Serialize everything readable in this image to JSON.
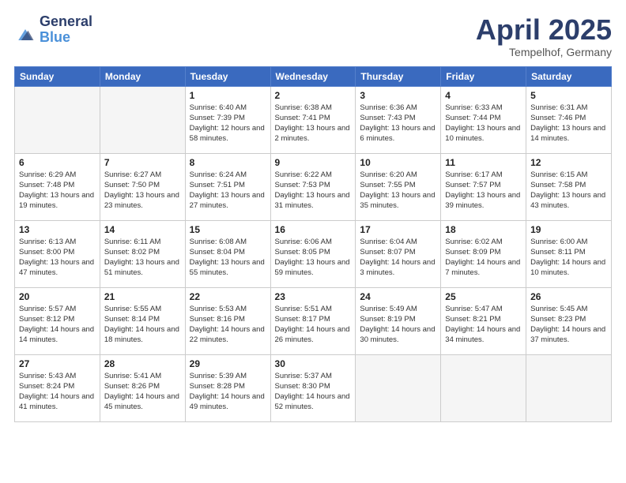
{
  "header": {
    "logo_general": "General",
    "logo_blue": "Blue",
    "month": "April 2025",
    "location": "Tempelhof, Germany"
  },
  "weekdays": [
    "Sunday",
    "Monday",
    "Tuesday",
    "Wednesday",
    "Thursday",
    "Friday",
    "Saturday"
  ],
  "weeks": [
    [
      {
        "day": "",
        "sunrise": "",
        "sunset": "",
        "daylight": ""
      },
      {
        "day": "",
        "sunrise": "",
        "sunset": "",
        "daylight": ""
      },
      {
        "day": "1",
        "sunrise": "Sunrise: 6:40 AM",
        "sunset": "Sunset: 7:39 PM",
        "daylight": "Daylight: 12 hours and 58 minutes."
      },
      {
        "day": "2",
        "sunrise": "Sunrise: 6:38 AM",
        "sunset": "Sunset: 7:41 PM",
        "daylight": "Daylight: 13 hours and 2 minutes."
      },
      {
        "day": "3",
        "sunrise": "Sunrise: 6:36 AM",
        "sunset": "Sunset: 7:43 PM",
        "daylight": "Daylight: 13 hours and 6 minutes."
      },
      {
        "day": "4",
        "sunrise": "Sunrise: 6:33 AM",
        "sunset": "Sunset: 7:44 PM",
        "daylight": "Daylight: 13 hours and 10 minutes."
      },
      {
        "day": "5",
        "sunrise": "Sunrise: 6:31 AM",
        "sunset": "Sunset: 7:46 PM",
        "daylight": "Daylight: 13 hours and 14 minutes."
      }
    ],
    [
      {
        "day": "6",
        "sunrise": "Sunrise: 6:29 AM",
        "sunset": "Sunset: 7:48 PM",
        "daylight": "Daylight: 13 hours and 19 minutes."
      },
      {
        "day": "7",
        "sunrise": "Sunrise: 6:27 AM",
        "sunset": "Sunset: 7:50 PM",
        "daylight": "Daylight: 13 hours and 23 minutes."
      },
      {
        "day": "8",
        "sunrise": "Sunrise: 6:24 AM",
        "sunset": "Sunset: 7:51 PM",
        "daylight": "Daylight: 13 hours and 27 minutes."
      },
      {
        "day": "9",
        "sunrise": "Sunrise: 6:22 AM",
        "sunset": "Sunset: 7:53 PM",
        "daylight": "Daylight: 13 hours and 31 minutes."
      },
      {
        "day": "10",
        "sunrise": "Sunrise: 6:20 AM",
        "sunset": "Sunset: 7:55 PM",
        "daylight": "Daylight: 13 hours and 35 minutes."
      },
      {
        "day": "11",
        "sunrise": "Sunrise: 6:17 AM",
        "sunset": "Sunset: 7:57 PM",
        "daylight": "Daylight: 13 hours and 39 minutes."
      },
      {
        "day": "12",
        "sunrise": "Sunrise: 6:15 AM",
        "sunset": "Sunset: 7:58 PM",
        "daylight": "Daylight: 13 hours and 43 minutes."
      }
    ],
    [
      {
        "day": "13",
        "sunrise": "Sunrise: 6:13 AM",
        "sunset": "Sunset: 8:00 PM",
        "daylight": "Daylight: 13 hours and 47 minutes."
      },
      {
        "day": "14",
        "sunrise": "Sunrise: 6:11 AM",
        "sunset": "Sunset: 8:02 PM",
        "daylight": "Daylight: 13 hours and 51 minutes."
      },
      {
        "day": "15",
        "sunrise": "Sunrise: 6:08 AM",
        "sunset": "Sunset: 8:04 PM",
        "daylight": "Daylight: 13 hours and 55 minutes."
      },
      {
        "day": "16",
        "sunrise": "Sunrise: 6:06 AM",
        "sunset": "Sunset: 8:05 PM",
        "daylight": "Daylight: 13 hours and 59 minutes."
      },
      {
        "day": "17",
        "sunrise": "Sunrise: 6:04 AM",
        "sunset": "Sunset: 8:07 PM",
        "daylight": "Daylight: 14 hours and 3 minutes."
      },
      {
        "day": "18",
        "sunrise": "Sunrise: 6:02 AM",
        "sunset": "Sunset: 8:09 PM",
        "daylight": "Daylight: 14 hours and 7 minutes."
      },
      {
        "day": "19",
        "sunrise": "Sunrise: 6:00 AM",
        "sunset": "Sunset: 8:11 PM",
        "daylight": "Daylight: 14 hours and 10 minutes."
      }
    ],
    [
      {
        "day": "20",
        "sunrise": "Sunrise: 5:57 AM",
        "sunset": "Sunset: 8:12 PM",
        "daylight": "Daylight: 14 hours and 14 minutes."
      },
      {
        "day": "21",
        "sunrise": "Sunrise: 5:55 AM",
        "sunset": "Sunset: 8:14 PM",
        "daylight": "Daylight: 14 hours and 18 minutes."
      },
      {
        "day": "22",
        "sunrise": "Sunrise: 5:53 AM",
        "sunset": "Sunset: 8:16 PM",
        "daylight": "Daylight: 14 hours and 22 minutes."
      },
      {
        "day": "23",
        "sunrise": "Sunrise: 5:51 AM",
        "sunset": "Sunset: 8:17 PM",
        "daylight": "Daylight: 14 hours and 26 minutes."
      },
      {
        "day": "24",
        "sunrise": "Sunrise: 5:49 AM",
        "sunset": "Sunset: 8:19 PM",
        "daylight": "Daylight: 14 hours and 30 minutes."
      },
      {
        "day": "25",
        "sunrise": "Sunrise: 5:47 AM",
        "sunset": "Sunset: 8:21 PM",
        "daylight": "Daylight: 14 hours and 34 minutes."
      },
      {
        "day": "26",
        "sunrise": "Sunrise: 5:45 AM",
        "sunset": "Sunset: 8:23 PM",
        "daylight": "Daylight: 14 hours and 37 minutes."
      }
    ],
    [
      {
        "day": "27",
        "sunrise": "Sunrise: 5:43 AM",
        "sunset": "Sunset: 8:24 PM",
        "daylight": "Daylight: 14 hours and 41 minutes."
      },
      {
        "day": "28",
        "sunrise": "Sunrise: 5:41 AM",
        "sunset": "Sunset: 8:26 PM",
        "daylight": "Daylight: 14 hours and 45 minutes."
      },
      {
        "day": "29",
        "sunrise": "Sunrise: 5:39 AM",
        "sunset": "Sunset: 8:28 PM",
        "daylight": "Daylight: 14 hours and 49 minutes."
      },
      {
        "day": "30",
        "sunrise": "Sunrise: 5:37 AM",
        "sunset": "Sunset: 8:30 PM",
        "daylight": "Daylight: 14 hours and 52 minutes."
      },
      {
        "day": "",
        "sunrise": "",
        "sunset": "",
        "daylight": ""
      },
      {
        "day": "",
        "sunrise": "",
        "sunset": "",
        "daylight": ""
      },
      {
        "day": "",
        "sunrise": "",
        "sunset": "",
        "daylight": ""
      }
    ]
  ]
}
